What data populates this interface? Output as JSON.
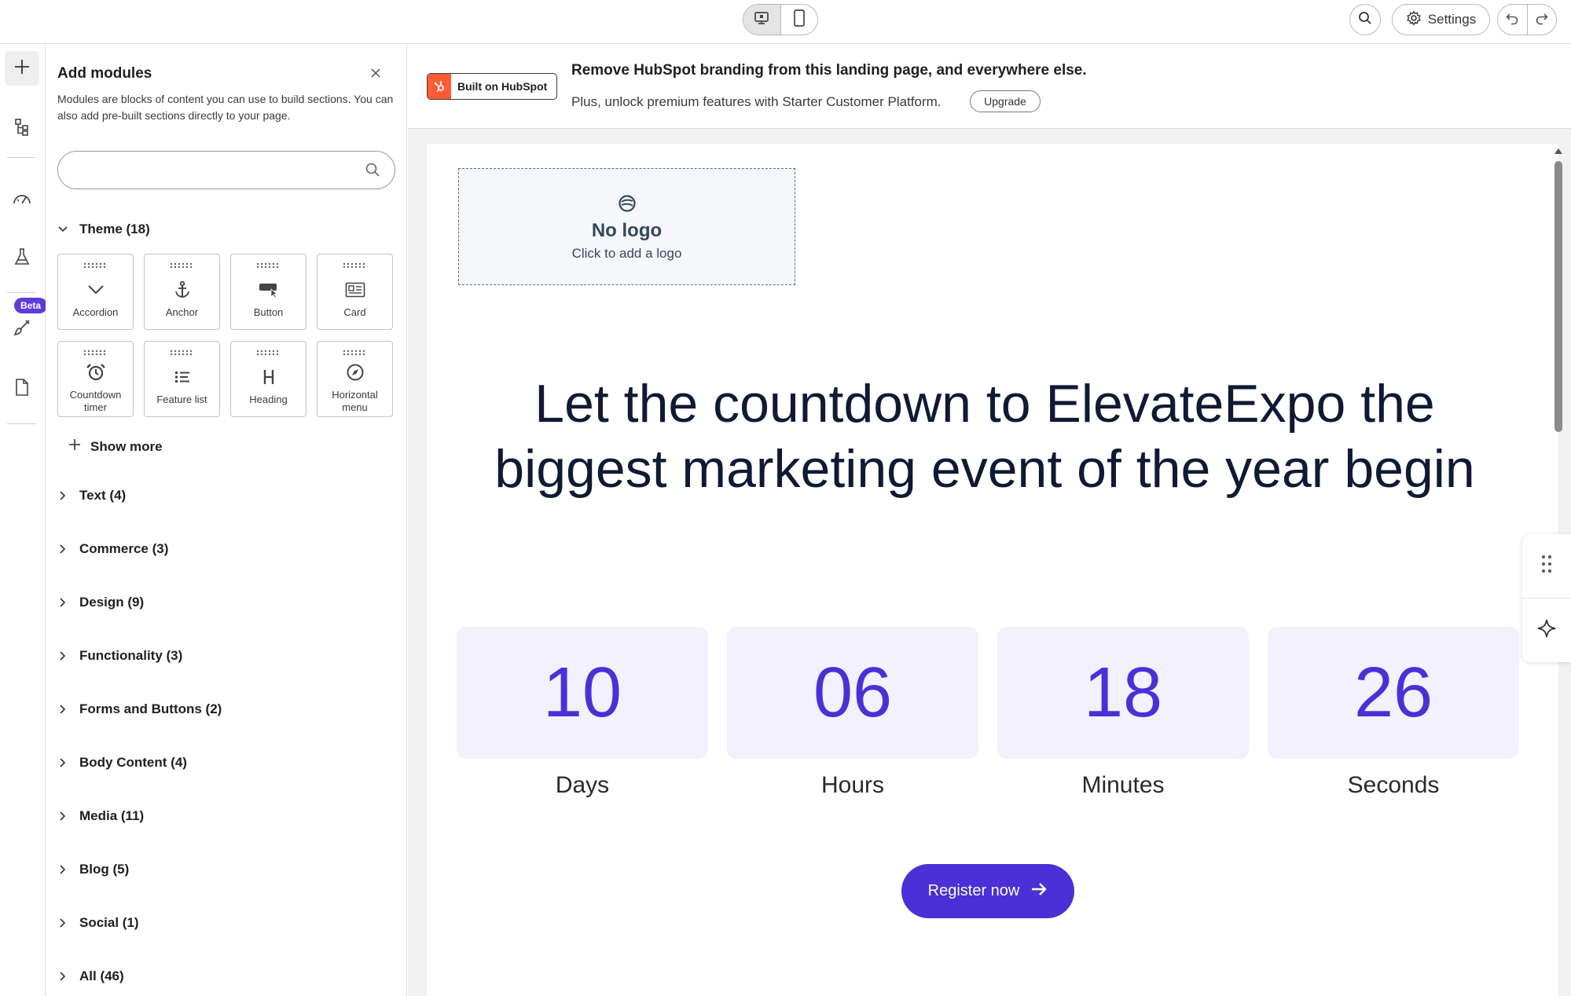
{
  "topbar": {
    "device_toggle": [
      {
        "name": "desktop",
        "icon": "monitor-icon",
        "active": true
      },
      {
        "name": "mobile",
        "icon": "phone-icon",
        "active": false
      }
    ],
    "settings_label": "Settings"
  },
  "rail": {
    "beta_label": "Beta",
    "items": [
      {
        "name": "add",
        "icon": "plus-icon"
      },
      {
        "name": "layers",
        "icon": "tree-icon"
      },
      {
        "name": "optimize",
        "icon": "gauge-icon"
      },
      {
        "name": "test",
        "icon": "flask-icon"
      },
      {
        "name": "design",
        "icon": "brush-icon"
      },
      {
        "name": "pages",
        "icon": "page-icon"
      }
    ]
  },
  "panel": {
    "title": "Add modules",
    "description": "Modules are blocks of content you can use to build sections. You can also add pre-built sections directly to your page.",
    "search_placeholder": "",
    "theme_label": "Theme (18)",
    "modules": [
      {
        "label": "Accordion",
        "icon": "chevron-down-icon"
      },
      {
        "label": "Anchor",
        "icon": "anchor-icon"
      },
      {
        "label": "Button",
        "icon": "button-icon"
      },
      {
        "label": "Card",
        "icon": "card-icon"
      },
      {
        "label": "Countdown timer",
        "icon": "alarm-clock-icon"
      },
      {
        "label": "Feature list",
        "icon": "list-icon"
      },
      {
        "label": "Heading",
        "icon": "heading-icon"
      },
      {
        "label": "Horizontal menu",
        "icon": "compass-icon"
      }
    ],
    "show_more_label": "Show more",
    "categories": [
      "Text (4)",
      "Commerce (3)",
      "Design (9)",
      "Functionality (3)",
      "Forms and Buttons (2)",
      "Body Content (4)",
      "Media (11)",
      "Blog (5)",
      "Social (1)",
      "All (46)"
    ]
  },
  "banner": {
    "badge_label": "Built on HubSpot",
    "title": "Remove HubSpot branding from this landing page, and everywhere else.",
    "subtitle": "Plus, unlock premium features with Starter Customer Platform.",
    "upgrade_label": "Upgrade",
    "brand_color": "#ff5c35"
  },
  "page": {
    "logo_title": "No logo",
    "logo_subtitle": "Click to add a logo",
    "headline": "Let the countdown to ElevateExpo the biggest marketing event of the year begin",
    "countdown": [
      {
        "value": "10",
        "label": "Days"
      },
      {
        "value": "06",
        "label": "Hours"
      },
      {
        "value": "18",
        "label": "Minutes"
      },
      {
        "value": "26",
        "label": "Seconds"
      }
    ],
    "register_label": "Register now",
    "accent_color": "#4a30d6"
  },
  "side_tools": [
    {
      "name": "drag",
      "icon": "grip-dots-icon"
    },
    {
      "name": "ai",
      "icon": "sparkle-icon"
    }
  ]
}
